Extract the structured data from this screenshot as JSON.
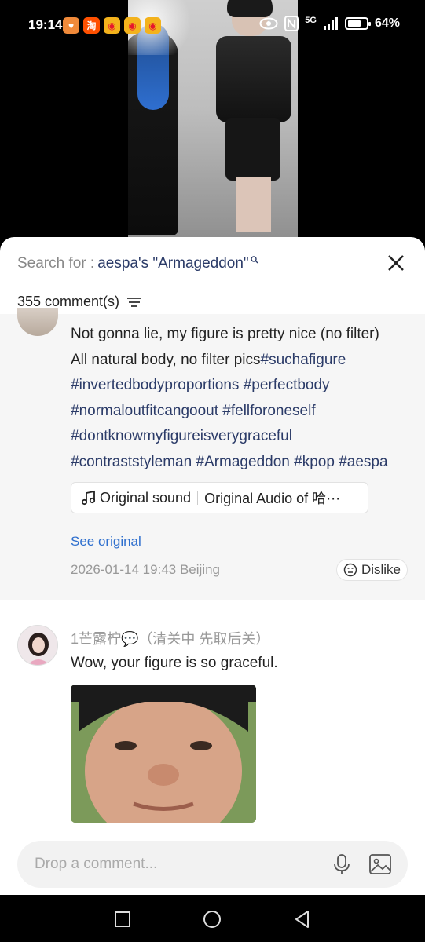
{
  "status_bar": {
    "time": "19:14",
    "apps": [
      {
        "icon": "heart-app-icon",
        "glyph": "♥",
        "color": "#f08a3a"
      },
      {
        "icon": "taobao-app-icon",
        "glyph": "淘",
        "color": "#ff5000"
      },
      {
        "icon": "weibo-app-icon",
        "glyph": "◉",
        "color": "#e6162d"
      },
      {
        "icon": "weibo-app-icon",
        "glyph": "◉",
        "color": "#e6162d"
      },
      {
        "icon": "weibo-app-icon",
        "glyph": "◉",
        "color": "#e6162d"
      }
    ],
    "more": "···",
    "network": "5G",
    "battery": "64%"
  },
  "search": {
    "prefix": "Search for :",
    "term": "aespa's \"Armageddon\""
  },
  "comments_header": {
    "count_label": "355 comment(s)"
  },
  "highlighted_comment": {
    "text_plain": "Not gonna lie, my figure is pretty nice (no filter) All natural body, no filter pics",
    "line1": "Not gonna lie, my figure is pretty nice (no filter)",
    "line2_plain": "All natural body, no filter pics",
    "tags": [
      "#suchafigure",
      "#invertedbodyproportions",
      "#perfectbody",
      "#normaloutfitcangoout",
      "#fellforoneself",
      "#dontknowmyfigureisverygraceful",
      "#contraststyleman",
      "#Armageddon",
      "#kpop",
      "#aespa"
    ],
    "sound": {
      "label": "Original sound",
      "detail": "Original Audio of 哈⋯"
    },
    "see_original": "See original",
    "timestamp": "2026-01-14 19:43",
    "location": "Beijing",
    "dislike_label": "Dislike"
  },
  "second_comment": {
    "username": "1芒露柠💬（清关中 先取后关）",
    "text": "Wow, your figure is so graceful."
  },
  "input": {
    "placeholder": "Drop a comment..."
  },
  "colors": {
    "hashtag": "#2b3b68",
    "link": "#2e6fce",
    "muted": "#999999"
  }
}
